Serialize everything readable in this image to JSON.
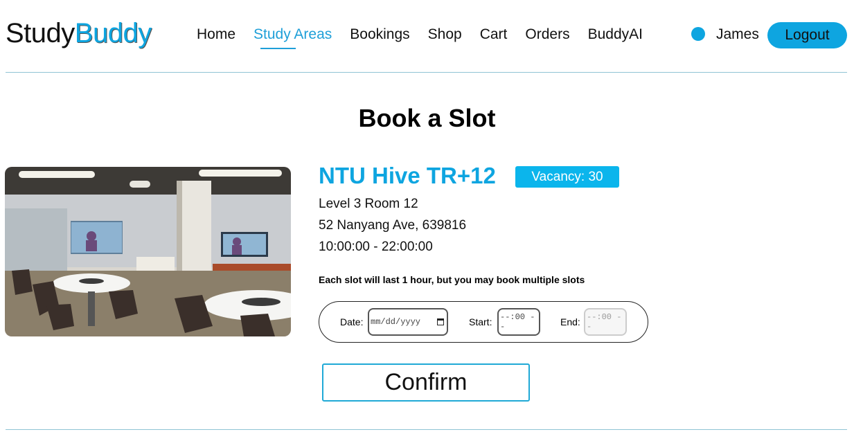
{
  "header": {
    "logo_part1": "Study",
    "logo_part2": "Buddy",
    "nav": [
      {
        "label": "Home"
      },
      {
        "label": "Study Areas",
        "active": true
      },
      {
        "label": "Bookings"
      },
      {
        "label": "Shop"
      },
      {
        "label": "Cart"
      },
      {
        "label": "Orders"
      },
      {
        "label": "BuddyAI"
      }
    ],
    "user_name": "James",
    "logout_label": "Logout"
  },
  "page": {
    "title": "Book a Slot"
  },
  "study_area": {
    "name": "NTU Hive TR+12",
    "vacancy": "Vacancy: 30",
    "location": "Level 3 Room 12",
    "address": "52 Nanyang Ave, 639816",
    "hours": "10:00:00 - 22:00:00",
    "photo_icon": "room-photo"
  },
  "booking": {
    "note": "Each slot will last 1 hour, but you may book multiple slots",
    "date_label": "Date:",
    "date_placeholder": "mm/dd/yyyy",
    "start_label": "Start:",
    "start_placeholder": "--:00 --",
    "end_label": "End:",
    "end_placeholder": "--:00 --",
    "confirm_label": "Confirm"
  },
  "colors": {
    "accent": "#0ea5e0",
    "vacancy_bg": "#0bb5ec",
    "rule": "#8fc4d4"
  }
}
